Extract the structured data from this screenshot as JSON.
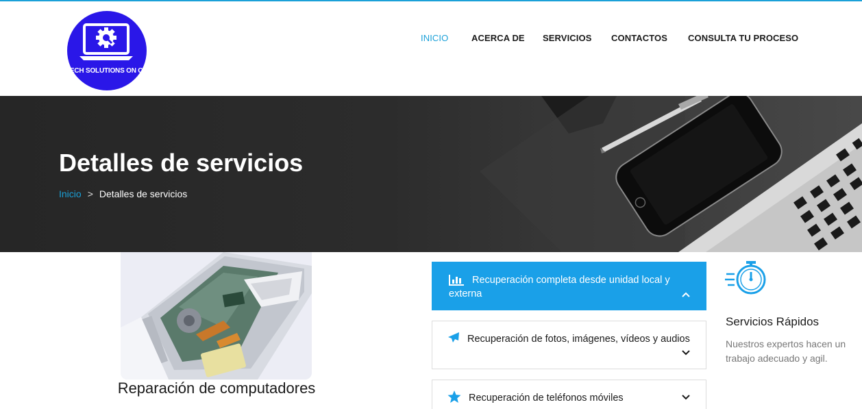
{
  "brand": {
    "logo_text": "TECH SOLUTIONS ON CALL",
    "logo_color": "#2a17e8"
  },
  "nav": {
    "items": [
      {
        "label": "INICIO",
        "active": true
      },
      {
        "label": "ACERCA DE",
        "active": false
      },
      {
        "label": "SERVICIOS",
        "active": false
      },
      {
        "label": "CONTACTOS",
        "active": false
      },
      {
        "label": "CONSULTA TU PROCESO",
        "active": false
      }
    ],
    "accent": "#1aa0d8"
  },
  "hero": {
    "title": "Detalles de servicios",
    "breadcrumb": {
      "home": "Inicio",
      "separator": ">",
      "current": "Detalles de servicios"
    }
  },
  "service": {
    "title": "Reparación de computadores"
  },
  "accordion": [
    {
      "label": "Recuperación completa desde unidad local y externa",
      "icon": "bar-chart-icon",
      "open": true
    },
    {
      "label": "Recuperación de fotos, imágenes, vídeos y audios",
      "icon": "plane-icon",
      "open": false
    },
    {
      "label": "Recuperación de teléfonos móviles",
      "icon": "star-icon",
      "open": false
    }
  ],
  "feature": {
    "icon": "stopwatch-icon",
    "title": "Servicios Rápidos",
    "text": "Nuestros expertos hacen un trabajo adecuado y agil."
  }
}
